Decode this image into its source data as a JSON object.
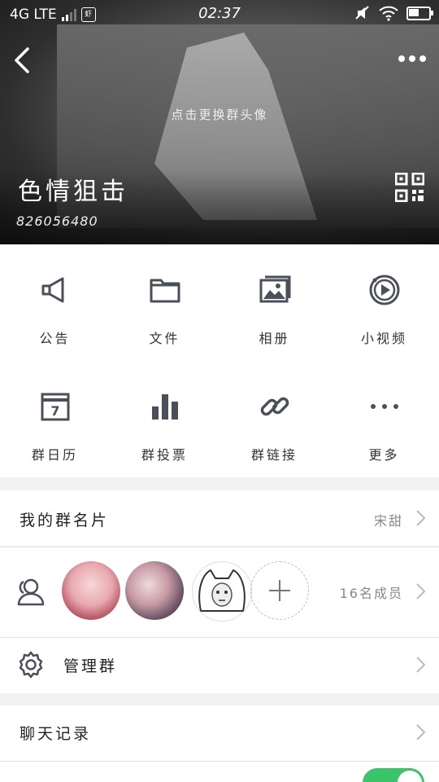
{
  "status_bar": {
    "network": "4G LTE",
    "notif_badge": "虾",
    "time": "02:37"
  },
  "header": {
    "change_avatar_hint": "点击更换群头像",
    "group_name": "色情狙击",
    "group_id": "826056480"
  },
  "features": [
    {
      "label": "公告",
      "icon": "megaphone-icon"
    },
    {
      "label": "文件",
      "icon": "folder-icon"
    },
    {
      "label": "相册",
      "icon": "album-icon"
    },
    {
      "label": "小视频",
      "icon": "video-icon"
    },
    {
      "label": "群日历",
      "icon": "calendar-icon"
    },
    {
      "label": "群投票",
      "icon": "vote-chart-icon"
    },
    {
      "label": "群链接",
      "icon": "link-icon"
    },
    {
      "label": "更多",
      "icon": "more-dots-icon"
    }
  ],
  "calendar_day": "7",
  "my_card": {
    "label": "我的群名片",
    "value": "宋甜"
  },
  "members": {
    "count_label": "16名成员"
  },
  "manage": {
    "label": "管理群"
  },
  "chat_history": {
    "label": "聊天记录"
  },
  "colors": {
    "accent_toggle": "#3bc46a",
    "icon": "#4a4f5a"
  }
}
